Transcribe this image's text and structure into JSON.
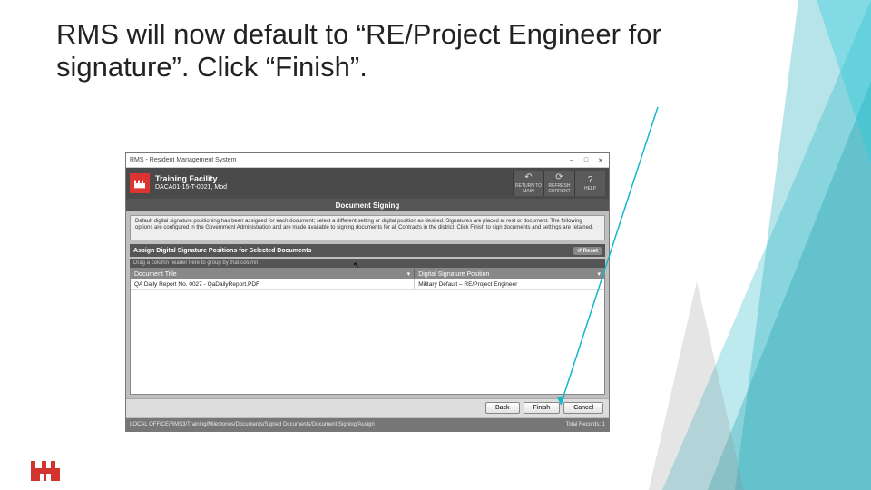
{
  "slide": {
    "title": "RMS will now default to “RE/Project Engineer for signature”. Click “Finish”."
  },
  "window": {
    "appTitle": "RMS - Resident Management System",
    "min": "–",
    "max": "□",
    "close": "✕"
  },
  "header": {
    "line1": "Training Facility",
    "line2": "DACA01-15-T-0021, Mod",
    "actions": {
      "back": "RETURN TO\nMAIN",
      "refresh": "REFRESH\nCURRENT",
      "help": "HELP"
    }
  },
  "bars": {
    "docSigning": "Document Signing",
    "assign": "Assign Digital Signature Positions for Selected Documents",
    "reset": "↺ Reset",
    "dragNote": "Drag a column header here to group by that column"
  },
  "info": "Default digital signature positioning has been assigned for each document; select a different setting or digital position as desired. Signatures are placed at rest or document. The following options are configured in the Government Administration and are made available to signing documents for all Contracts in the district. Click Finish to sign documents and settings are retained.",
  "table": {
    "col1": "Document Title",
    "col2": "Digital Signature Position",
    "row": {
      "title": "QA Daily Report No. 0027 - QaDailyReport.PDF",
      "position": "Military Default – RE/Project Engineer"
    }
  },
  "buttons": {
    "back": "Back",
    "finish": "Finish",
    "cancel": "Cancel"
  },
  "status": {
    "path": "LOCAL OFFICE/RMS3/Training/Milestones/Documents/Signed Documents/Document Signing/Assign",
    "right": "Total Records: 1"
  },
  "icons": {
    "backArrow": "↶",
    "refresh": "⟳",
    "help": "?",
    "filter": "▾"
  }
}
